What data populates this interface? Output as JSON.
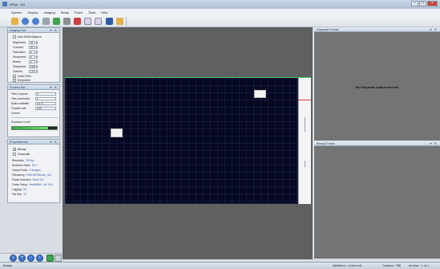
{
  "window": {
    "title": "vPlus - 3/4"
  },
  "menu": [
    "System",
    "Display",
    "Imaging",
    "Setup",
    "Flush",
    "Tools",
    "Help"
  ],
  "toolbar_icons": [
    "open-folder-icon",
    "undo-icon",
    "redo-icon",
    "cut-icon",
    "start-icon",
    "record-icon",
    "stop-icon",
    "flag-icon",
    "flag-icon",
    "grid-icon",
    "folder-icon"
  ],
  "imaging_tool": {
    "title": "Imaging Tool",
    "autowhite_label": "Auto White Balance",
    "params": [
      {
        "label": "Brightness",
        "value": "40"
      },
      {
        "label": "Contrast",
        "value": "50"
      },
      {
        "label": "Saturation",
        "value": "0"
      },
      {
        "label": "Sharpness",
        "value": "0"
      },
      {
        "label": "Blacks",
        "value": "0"
      },
      {
        "label": "Sharpness",
        "value": "100"
      },
      {
        "label": "Gamma",
        "value": "-75"
      }
    ],
    "invert_label": "Invert Filter",
    "despeckle_label": "Despeckle"
  },
  "process_bar": {
    "title": "Process Bar",
    "rows": [
      {
        "label": "Files in queue",
        "value": "0"
      },
      {
        "label": "Files processed",
        "value": "0"
      },
      {
        "label": "Bytes available",
        "value": "0.0 %"
      },
      {
        "label": "Transfer rate",
        "value": "0.00"
      },
      {
        "label": "Current",
        "value": ""
      }
    ],
    "exposure_label": "Exposure Level",
    "exposure_level": 0.8
  },
  "properties": {
    "title": "Properties Bar",
    "bitmap_label": "Bitmap",
    "grayscale_label": "Grayscale",
    "items": [
      {
        "label": "Resolution",
        "value": "200 dpi"
      },
      {
        "label": "Reduction Ratio",
        "value": "32:1"
      },
      {
        "label": "Output Folder",
        "value": "F:\\Images"
      },
      {
        "label": "Filenaming",
        "value": "Prefix-BTHAGain_001"
      },
      {
        "label": "Frame Detection",
        "value": "Fixed: 8.0"
      },
      {
        "label": "Frame Sizing",
        "value": "FixedWidth - A4 To B"
      },
      {
        "label": "Logging",
        "value": "Off"
      },
      {
        "label": "File Size",
        "value": "70"
      }
    ]
  },
  "grayscale_frame": {
    "title": "Grayscale Frame",
    "message": "No Grayscale output selected"
  },
  "bitmap_frame": {
    "title": "Bitmap Frame"
  },
  "status": {
    "left": "Ready",
    "middle": "IdleMotor = Color mA",
    "right1": "Camera : 785",
    "right2": "Archive : 1 of 1"
  }
}
